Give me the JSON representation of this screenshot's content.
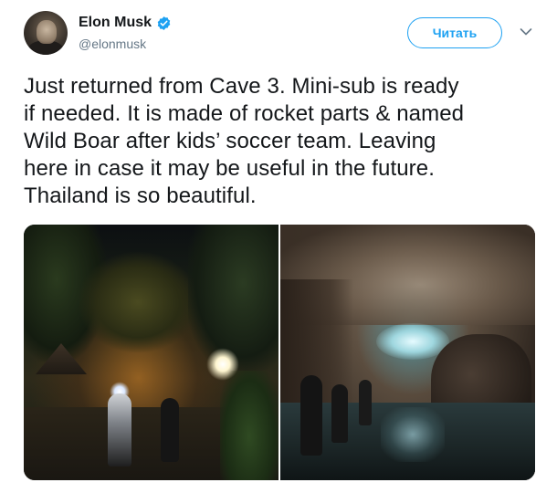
{
  "author": {
    "display_name": "Elon Musk",
    "handle": "@elonmusk",
    "verified": true
  },
  "follow_button": {
    "label": "Читать"
  },
  "tweet": {
    "text_lines": [
      "Just returned from Cave 3. Mini-sub is ready",
      "if needed. It is made of rocket parts & named",
      "Wild Boar after kids’ soccer team. Leaving",
      "here in case it may be useful in the future.",
      "Thailand is so beautiful."
    ]
  },
  "media": {
    "photo_count": 2
  },
  "colors": {
    "accent": "#1da1f2",
    "text": "#14171a",
    "secondary_text": "#657786"
  },
  "icons": {
    "verified": "verified-badge-icon",
    "menu": "chevron-down-icon"
  }
}
